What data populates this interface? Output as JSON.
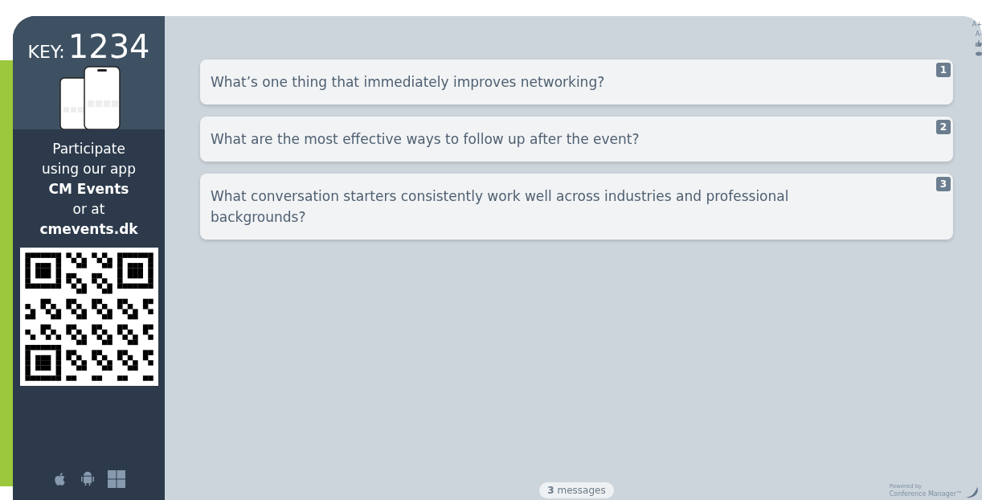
{
  "sidebar": {
    "key_label": "KEY:",
    "key_value": "1234",
    "participate_lines": [
      "Participate",
      "using our app"
    ],
    "app_name": "CM Events",
    "or_text": "or at",
    "website": "cmevents.dk"
  },
  "toolbar": [
    "A+",
    "A-"
  ],
  "questions": [
    {
      "number": "1",
      "text": "What’s one thing that immediately improves networking?"
    },
    {
      "number": "2",
      "text": "What are the most effective ways to follow up after the event?"
    },
    {
      "number": "3",
      "text": "What conversation starters consistently work well across industries and professional backgrounds?"
    }
  ],
  "footer": {
    "count": "3",
    "count_label": "messages",
    "powered_by": "Powered by",
    "brand": "Conference Manager™"
  }
}
